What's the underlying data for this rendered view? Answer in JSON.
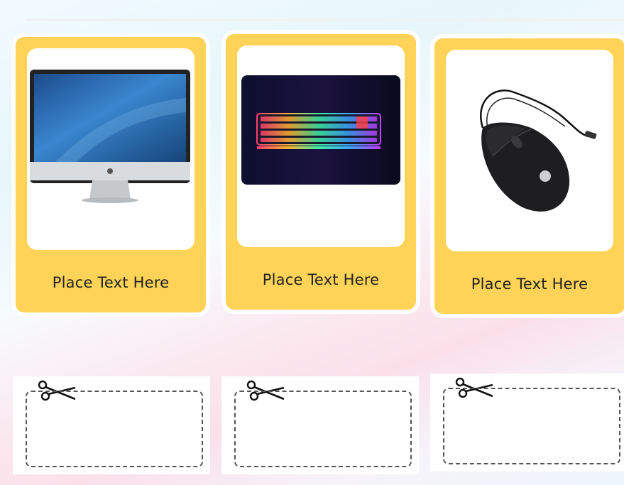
{
  "cards": [
    {
      "label": "Place Text Here",
      "image_icon": "imac-computer-icon"
    },
    {
      "label": "Place Text Here",
      "image_icon": "rgb-keyboard-icon"
    },
    {
      "label": "Place Text Here",
      "image_icon": "computer-mouse-icon"
    }
  ],
  "cut_out_boxes": [
    {
      "icon": "scissors-icon"
    },
    {
      "icon": "scissors-icon"
    },
    {
      "icon": "scissors-icon"
    }
  ],
  "colors": {
    "card": "#fed357",
    "card_inner": "#ffffff",
    "label_text": "#222222",
    "dash_border": "#555555"
  }
}
